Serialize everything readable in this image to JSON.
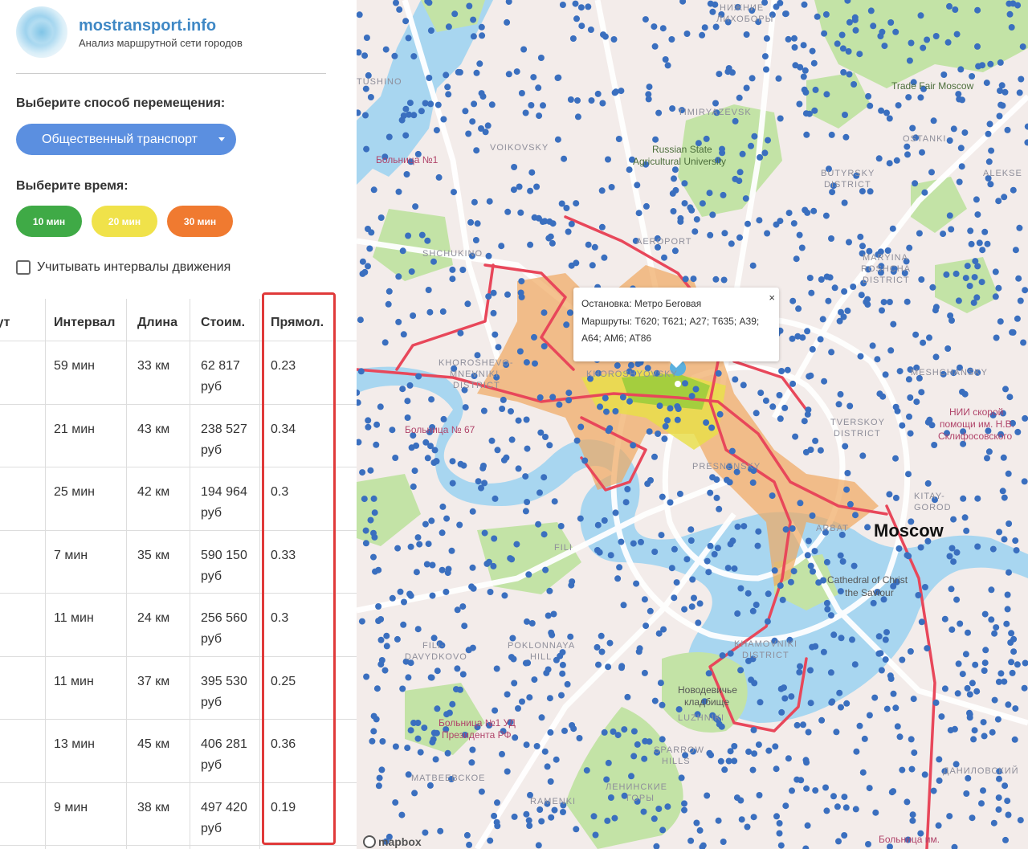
{
  "brand": {
    "title": "mostransport.info",
    "subtitle": "Анализ маршрутной сети городов"
  },
  "mode": {
    "label": "Выберите способ перемещения:",
    "selected": "Общественный транспорт"
  },
  "time": {
    "label": "Выберите время:",
    "options": [
      {
        "label": "10 мин",
        "color": "#3faa46"
      },
      {
        "label": "20 мин",
        "color": "#f0e24a"
      },
      {
        "label": "30 мин",
        "color": "#f07a30"
      }
    ]
  },
  "intervals_checkbox": {
    "label": "Учитывать интервалы движения",
    "checked": false
  },
  "table": {
    "headers": [
      "рут",
      "Интервал",
      "Длина",
      "Стоим.",
      "Прямол."
    ],
    "rows": [
      {
        "interval": "59 мин",
        "length": "33 км",
        "cost": "62 817 руб",
        "straightness": "0.23"
      },
      {
        "interval": "21 мин",
        "length": "43 км",
        "cost": "238 527 руб",
        "straightness": "0.34"
      },
      {
        "interval": "25 мин",
        "length": "42 км",
        "cost": "194 964 руб",
        "straightness": "0.3"
      },
      {
        "interval": "7 мин",
        "length": "35 км",
        "cost": "590 150 руб",
        "straightness": "0.33"
      },
      {
        "interval": "11 мин",
        "length": "24 км",
        "cost": "256 560 руб",
        "straightness": "0.3"
      },
      {
        "interval": "11 мин",
        "length": "37 км",
        "cost": "395 530 руб",
        "straightness": "0.25"
      },
      {
        "interval": "13 мин",
        "length": "45 км",
        "cost": "406 281 руб",
        "straightness": "0.36"
      },
      {
        "interval": "9 мин",
        "length": "38 км",
        "cost": "497 420 руб",
        "straightness": "0.19"
      }
    ]
  },
  "popup": {
    "stop": "Остановка: Метро Беговая",
    "routes": "Маршруты: Т620; Т621; А27; Т635; А39; А64; АМ6; АТ86",
    "close": "×"
  },
  "map": {
    "attribution": "mapbox",
    "labels": {
      "nizhnie": "НИЖНИЕ",
      "likhobory": "ЛИХОБОРЫ",
      "tushino": "TUSHINO",
      "timiryazevsky": "TIMIRYAZEVSK",
      "voikovsky": "VOIKOVSKY",
      "trade_fair": "Trade Fair Moscow",
      "agri_univ_1": "Russian State",
      "agri_univ_2": "Agricultural University",
      "hospital1": "Больница №1",
      "butyrsky_1": "BUTYRSKY",
      "butyrsky_2": "DISTRICT",
      "alekseev": "ALEKSE",
      "ostankino": "OSTANKI",
      "aeroport": "AEROPORT",
      "shchukino": "SHCHUKINO",
      "maryina_1": "MARYINA",
      "maryina_2": "ROSHCHA",
      "maryina_3": "DISTRICT",
      "khoroshevo_1": "KHOROSHEVO-",
      "khoroshevo_2": "MNEVNIKI",
      "khoroshevo_3": "DISTRICT",
      "khoroshevsky": "KHOROSHYOVSKY",
      "meshchansky": "MESHCHANSKY",
      "hospital67": "Больница № 67",
      "tverskoy_1": "TVERSKOY",
      "tverskoy_2": "DISTRICT",
      "sklif_1": "НИИ скорой",
      "sklif_2": "помощи им. Н.В.",
      "sklif_3": "Склифосовского",
      "presnensky": "PRESNENSKY",
      "kitay_1": "KITAY-",
      "kitay_2": "GOROD",
      "moscow": "Moscow",
      "arbat": "ARBAT",
      "fili": "FILI",
      "cathedral_1": "Cathedral of Christ",
      "cathedral_2": "the Saviour",
      "fili_davydkovo_1": "FILI-",
      "fili_davydkovo_2": "DAVYDKOVO",
      "poklonnaya_1": "POKLONNAYA",
      "poklonnaya_2": "HILL",
      "khamovniki_1": "KHAMOVNIKI",
      "khamovniki_2": "DISTRICT",
      "novodevichye_1": "Новодевичье",
      "novodevichye_2": "кладбище",
      "luzhniki": "LUZHNIKI",
      "hospital_ud_1": "Больница №1 УД",
      "hospital_ud_2": "Президента РФ",
      "sparrow_1": "SPARROW",
      "sparrow_2": "HILLS",
      "matveevskoe": "МАТВЕЕВСКОЕ",
      "leninskie_1": "ЛЕНИНСКИЕ",
      "leninskie_2": "ГОРЫ",
      "ramenki": "RAMENKI",
      "danilovsky": "ДАНИЛОВСКИЙ",
      "hospital_im": "Больница им."
    }
  }
}
